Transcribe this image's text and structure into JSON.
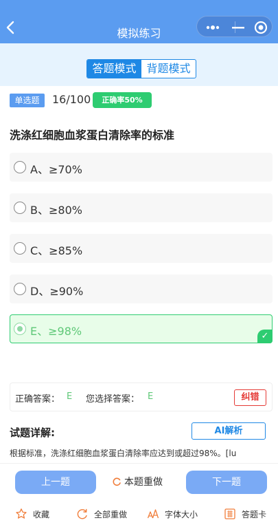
{
  "header": {
    "title": "模拟练习"
  },
  "mode_tabs": [
    {
      "label": "答题模式",
      "active": true
    },
    {
      "label": "背题模式",
      "active": false
    }
  ],
  "question": {
    "type": "单选题",
    "progress": "16/100",
    "accuracy": "正确率50%",
    "stem": "洗涤红细胞血浆蛋白清除率的标准",
    "options": [
      {
        "label": "A、≥70%",
        "selected": false
      },
      {
        "label": "B、≥80%",
        "selected": false
      },
      {
        "label": "C、≥85%",
        "selected": false
      },
      {
        "label": "D、≥90%",
        "selected": false
      },
      {
        "label": "E、≥98%",
        "selected": true
      }
    ]
  },
  "answer": {
    "correct_label": "正确答案：",
    "correct_value": "E",
    "chosen_label": "您选择答案：",
    "chosen_value": "E",
    "report_error": "纠错"
  },
  "detail": {
    "title": "试题详解:",
    "ai_button": "AI解析",
    "text": "根据标准，洗涤红细胞血浆蛋白清除率应达到或超过98%。[lu"
  },
  "nav": {
    "prev": "上一题",
    "redo_one": "本题重做",
    "next": "下一题"
  },
  "toolbar": {
    "favorite": "收藏",
    "redo_all": "全部重做",
    "font_size": "字体大小",
    "answer_card": "答题卡"
  },
  "colors": {
    "header": "#5b9cf0",
    "accent": "#1e88e5",
    "correct": "#2ecc71",
    "error": "#e53935"
  }
}
